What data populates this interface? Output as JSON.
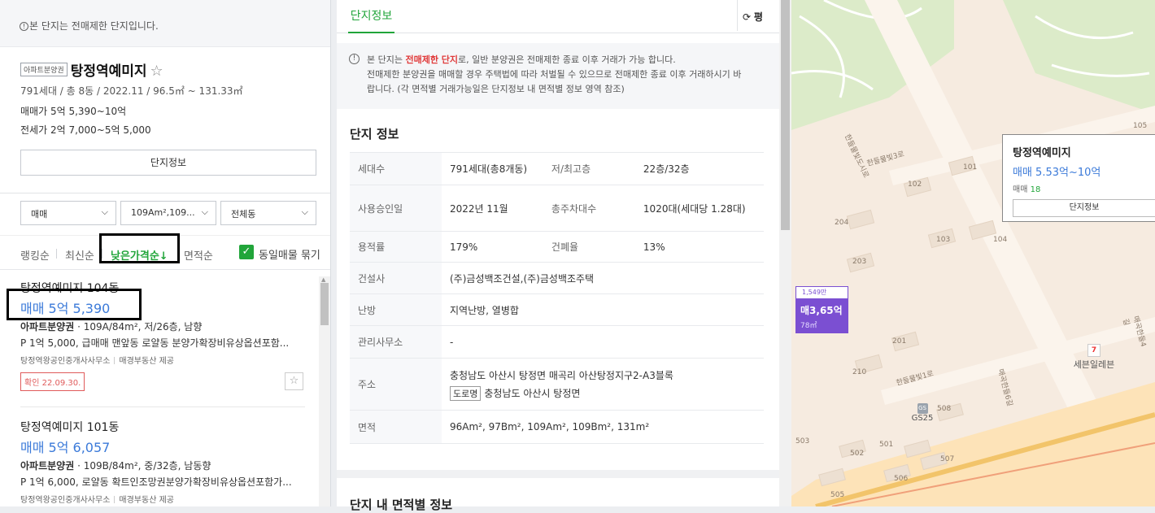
{
  "left": {
    "notice": "본 단지는 전매제한 단지입니다.",
    "badge": "아파트분양권",
    "complex_name": "탕정역예미지",
    "meta": "791세대 / 총 8동 / 2022.11 / 96.5㎡ ~ 131.33㎡",
    "sale_label": "매매가",
    "sale_value": "5억 5,390~10억",
    "jeonse_label": "전세가",
    "jeonse_value": "2억 7,000~5억 5,000",
    "info_button": "단지정보",
    "filters": {
      "trade_type": "매매",
      "area": "109Am²,109...",
      "dong": "전체동"
    },
    "sort": {
      "ranking": "랭킹순",
      "latest": "최신순",
      "low_price": "낮은가격순↓",
      "area": "면적순",
      "group_same": "동일매물 묶기"
    },
    "listings": [
      {
        "title": "탕정역예미지 104동",
        "price": "매매 5억 5,390",
        "type": "아파트분양권",
        "desc": "109A/84m², 저/26층, 남향",
        "note": "P 1억 5,000, 급매매 맨앞동 로얄동 분양가확장비유상옵션포함...",
        "agent": "탕정역왕공인중개사사무소",
        "provider": "매경부동산 제공",
        "confirm": "확인 22.09.30."
      },
      {
        "title": "탕정역예미지 101동",
        "price": "매매 5억 6,057",
        "type": "아파트분양권",
        "desc": "109B/84m², 중/32층, 남동향",
        "note": "P 1억 6,000, 로얄동 확트인조망권분양가확장비유상옵션포함가...",
        "agent": "탕정역왕공인중개사사무소",
        "provider": "매경부동산 제공"
      }
    ]
  },
  "middle": {
    "tab": "단지정보",
    "unit_button": "평",
    "warning_prefix": "본 단지는 ",
    "warning_red": "전매제한 단지",
    "warning_line1_rest": "로, 일반 분양권은 전매제한 종료 이후 거래가 가능 합니다.",
    "warning_line2": "전매제한 분양권을 매매할 경우 주택법에 따라 처벌될 수 있으므로 전매제한 종료 이후 거래하시기 바",
    "warning_line3": "랍니다. (각 면적별 거래가능일은 단지정보 내 면적별 정보 영역 참조)",
    "section_title": "단지 정보",
    "table": {
      "households_label": "세대수",
      "households": "791세대(총8개동)",
      "floors_label": "저/최고층",
      "floors": "22층/32층",
      "approval_label": "사용승인일",
      "approval": "2022년 11월",
      "parking_label": "총주차대수",
      "parking": "1020대(세대당 1.28대)",
      "far_label": "용적률",
      "far": "179%",
      "bcr_label": "건폐율",
      "bcr": "13%",
      "builder_label": "건설사",
      "builder": "(주)금성백조건설,(주)금성백조주택",
      "heating_label": "난방",
      "heating": "지역난방, 열병합",
      "office_label": "관리사무소",
      "office": "-",
      "address_label": "주소",
      "address": "충청남도 아산시 탕정면 매곡리 아산탕정지구2-A3블록",
      "road_tag": "도로명",
      "road_address": "충청남도 아산시 탕정면",
      "area_label": "면적",
      "area": "96Am², 97Bm², 109Am², 109Bm², 131m²"
    },
    "section2_title": "단지 내 면적별 정보"
  },
  "map": {
    "popup_title": "탕정역예미지",
    "popup_price": "매매 5.53억~10억",
    "popup_count_label": "매매",
    "popup_count": "18",
    "popup_button": "단지정보",
    "marker_top": "1,549만",
    "marker_price": "매3,65억",
    "marker_size": "78㎡",
    "store": "세븐일레븐",
    "store_icon": "7",
    "gas": "GS25",
    "gas_icon": "GS",
    "road1": "한들물빛3로",
    "road2": "한들물빛도시로",
    "road3": "한들물빛1로",
    "road4": "매곡한들6길",
    "road5": "매곡한들4길",
    "buildings": [
      "101",
      "102",
      "103",
      "104",
      "105",
      "201",
      "203",
      "204",
      "210",
      "501",
      "502",
      "503",
      "505",
      "506",
      "507",
      "508"
    ]
  }
}
